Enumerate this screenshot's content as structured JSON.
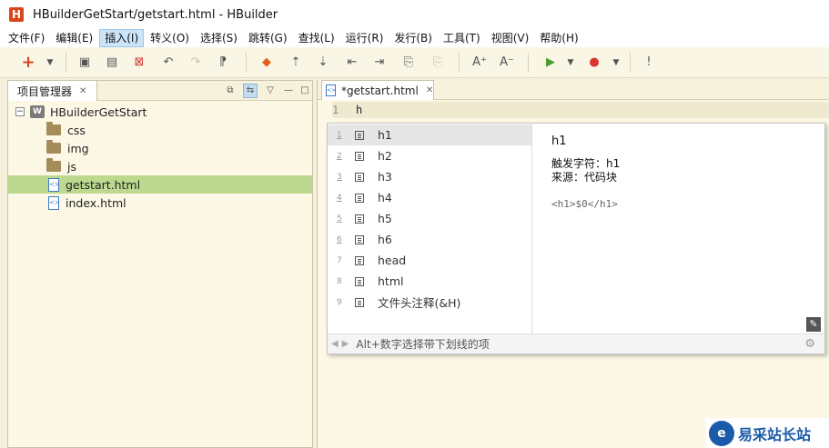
{
  "window": {
    "title": "HBuilderGetStart/getstart.html  -  HBuilder",
    "logo_letter": "H"
  },
  "menu": [
    "文件(F)",
    "编辑(E)",
    "插入(I)",
    "转义(O)",
    "选择(S)",
    "跳转(G)",
    "查找(L)",
    "运行(R)",
    "发行(B)",
    "工具(T)",
    "视图(V)",
    "帮助(H)"
  ],
  "menu_active": "插入(I)",
  "project_panel": {
    "tab_label": "项目管理器",
    "project": "HBuilderGetStart",
    "project_icon_letter": "W",
    "folders": [
      "css",
      "img",
      "js"
    ],
    "files": [
      "getstart.html",
      "index.html"
    ],
    "selected": "getstart.html"
  },
  "editor": {
    "tab_label": "*getstart.html",
    "line_number": "1",
    "code": "h"
  },
  "autocomplete": {
    "items": [
      {
        "num": "1",
        "label": "h1"
      },
      {
        "num": "2",
        "label": "h2"
      },
      {
        "num": "3",
        "label": "h3"
      },
      {
        "num": "4",
        "label": "h4"
      },
      {
        "num": "5",
        "label": "h5"
      },
      {
        "num": "6",
        "label": "h6"
      },
      {
        "num": "7",
        "label": "head"
      },
      {
        "num": "8",
        "label": "html"
      },
      {
        "num": "9",
        "label": "文件头注释(&H)"
      }
    ],
    "detail": {
      "title": "h1",
      "trigger": "触发字符：h1",
      "source": "来源：代码块",
      "snippet": "<h1>$0</h1>"
    },
    "footer_hint": "Alt+数字选择带下划线的项"
  },
  "watermark": {
    "text": "易采站长站"
  },
  "colors": {
    "accent_orange": "#e0631c",
    "selection_green": "#bcd98f",
    "brand_red": "#d9461c"
  }
}
